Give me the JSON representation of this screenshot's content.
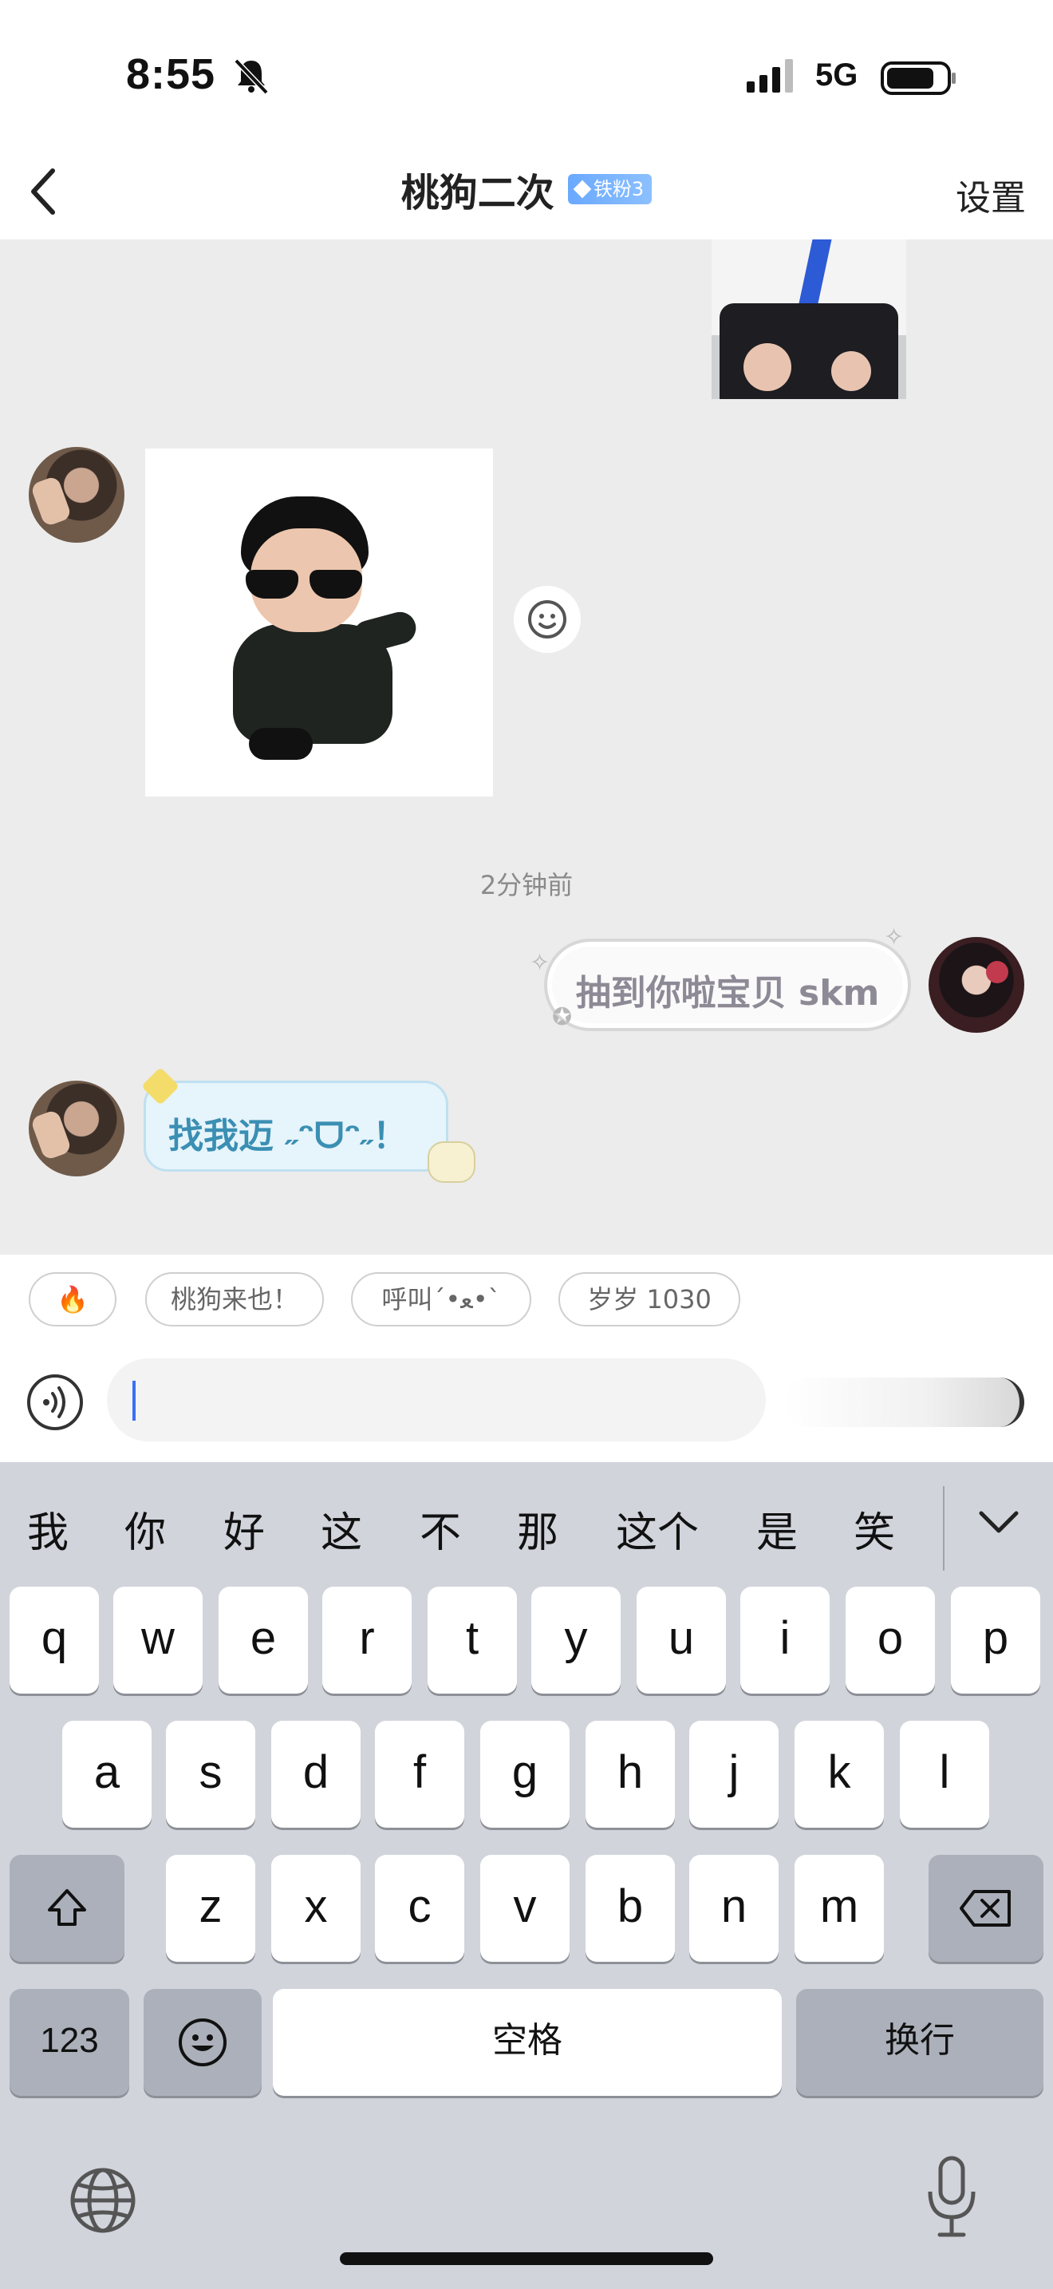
{
  "status_bar": {
    "time": "8:55",
    "network": "5G",
    "icons": [
      "bell-muted-icon",
      "signal-icon",
      "battery-icon"
    ]
  },
  "nav": {
    "title": "桃狗二次",
    "badge": "铁粉3",
    "settings": "设置",
    "back_icon": "chevron-left-icon"
  },
  "chat": {
    "timestamp": "2分钟前",
    "outgoing_message": "抽到你啦宝贝 skm",
    "incoming_message": "找我迈 ˶ᵔᗜᵔ˶！"
  },
  "quick_replies": [
    "🔥",
    "桃狗来也！",
    "呼叫´•ﻌ•`",
    "岁岁 1030"
  ],
  "input": {
    "value": ""
  },
  "keyboard": {
    "candidates": [
      "我",
      "你",
      "好",
      "这",
      "不",
      "那",
      "这个",
      "是",
      "笑"
    ],
    "row1": [
      "q",
      "w",
      "e",
      "r",
      "t",
      "y",
      "u",
      "i",
      "o",
      "p"
    ],
    "row2": [
      "a",
      "s",
      "d",
      "f",
      "g",
      "h",
      "j",
      "k",
      "l"
    ],
    "row3": [
      "z",
      "x",
      "c",
      "v",
      "b",
      "n",
      "m"
    ],
    "numbers_key": "123",
    "space_key": "空格",
    "return_key": "换行"
  },
  "colors": {
    "accent": "#3b6ff5",
    "keyboard_bg": "#d1d4db",
    "chat_bg": "#ececec",
    "badge": "#6aa9ff"
  }
}
